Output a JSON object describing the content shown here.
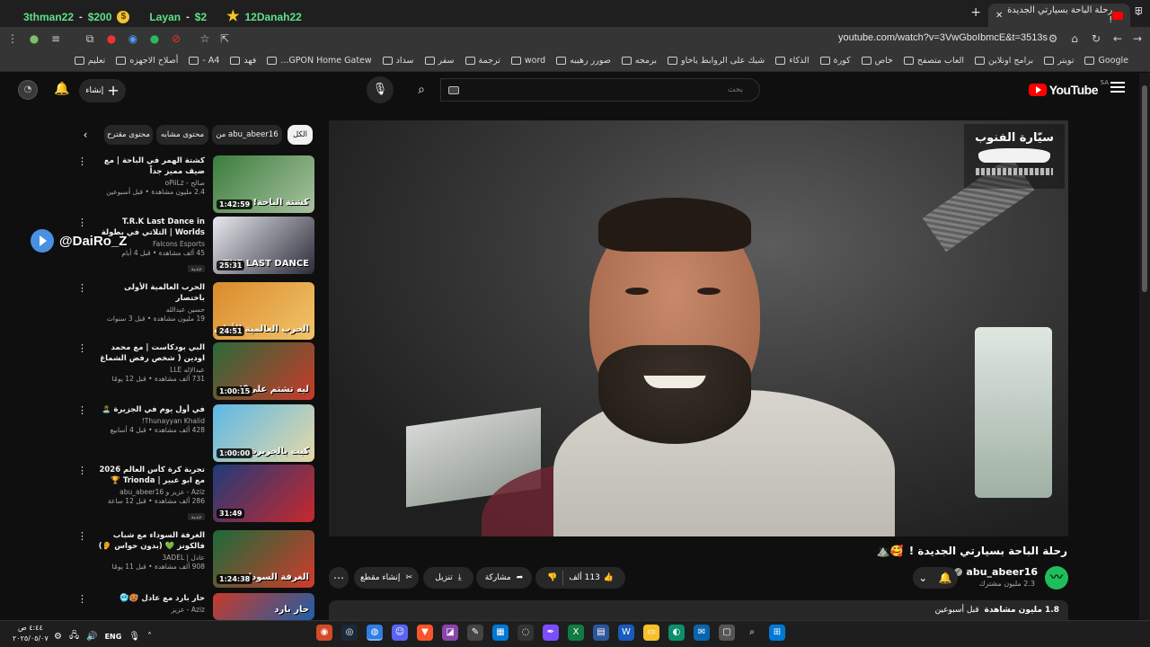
{
  "overlay": {
    "donations": [
      {
        "name": "3thman22",
        "amount": "$200"
      },
      {
        "name": "Layan",
        "amount": "$2"
      },
      {
        "name": "12Danah22",
        "amount": ""
      }
    ]
  },
  "browser": {
    "tab_title": "رحلة الباحة بسيارتي الجديدة !",
    "url": "youtube.com/watch?v=3VwGboIbmcE&t=3513s",
    "bookmarks": [
      "Google",
      "تويتر",
      "برامج اونلاين",
      "العاب متصفح",
      "خاص",
      "كورة",
      "الذكاء",
      "شيك على الروابط ياخاو",
      "برمجه",
      "صورر رهيبه",
      "word",
      "ترجمة",
      "سفر",
      "سداد",
      "GPON Home Gatew...",
      "فهد",
      "A4 -",
      "أصلاح الاجهزه",
      "تعليم"
    ]
  },
  "youtube": {
    "logo": "YouTube",
    "country": "SA",
    "search_placeholder": "بحث",
    "create_label": "إنشاء"
  },
  "chips": [
    "الكل",
    "من abu_abeer16",
    "محتوى مشابه",
    "محتوى مقترح"
  ],
  "video": {
    "title": "رحلة الباحة بسيارتي الجديدة !",
    "channel": "abu_abeer16",
    "subscribers": "2.3 مليون مشترك",
    "likes": "113 ألف",
    "share": "مشاركة",
    "download": "تنزيل",
    "clip": "إنشاء مقطع",
    "views": "1.8 مليون مشاهدة",
    "age": "قبل أسبوعين",
    "overlay_logo": "سيّارة الفنوب"
  },
  "floating_tag": "@DaiRo_Z",
  "recommendations": [
    {
      "title": "كشتة الهمر في الباحة | مع ضيف مميز جداً",
      "channel": "صالح - oPiiLz",
      "meta": "2.4 مليون مشاهدة • قبل أسبوعين",
      "duration": "1:42:59",
      "thumb_text": "كشتة الباحة!",
      "new": false,
      "bg": [
        "#3b7d3c",
        "#a8c2a0"
      ]
    },
    {
      "title": "T.R.K Last Dance in Worlds | التلاتي في بطولة العالم",
      "channel": "Falcons Esports",
      "meta": "45 ألف مشاهدة • قبل 4 أيام",
      "duration": "25:31",
      "thumb_text": "THE LAST DANCE",
      "new": true,
      "bg": [
        "#e8e8ee",
        "#2c2c3a"
      ]
    },
    {
      "title": "الحرب العالمية الأولى باختصار",
      "channel": "حسين عبدالله",
      "meta": "19 مليون مشاهدة • قبل 3 سنوات",
      "duration": "24:51",
      "thumb_text": "الحرب العالمية الأولى",
      "new": false,
      "bg": [
        "#d98b2b",
        "#f2c46a"
      ]
    },
    {
      "title": "البي بودكاست | مع محمد اودين ( شخص رفض الشماغ للتريق 😂 )",
      "channel": "عبدالإله LLE",
      "meta": "731 ألف مشاهدة • قبل 12 يومًا",
      "duration": "1:00:15",
      "thumb_text": "ليه تشتم علي؟!",
      "new": false,
      "bg": [
        "#2b6a3a",
        "#c93a2a"
      ]
    },
    {
      "title": "في أول يوم في الجزيرة 🏝️",
      "channel": "Thunayyan Khalid!",
      "meta": "428 ألف مشاهدة • قبل 4 أسابيع",
      "duration": "1:00:00",
      "thumb_text": "كبت بالجزيرة",
      "new": false,
      "bg": [
        "#5bb7e6",
        "#e7d9a6"
      ]
    },
    {
      "title": "تجربة كرة كأس العالم 2026 مع ابو عبير | Trionda 🏆",
      "channel": "Aziz - عزيز و abu_abeer16",
      "meta": "286 ألف مشاهدة • قبل 12 ساعة",
      "duration": "31:49",
      "thumb_text": "",
      "new": true,
      "bg": [
        "#1e3b7a",
        "#c9282d"
      ]
    },
    {
      "title": "الغرفة السوداء مع شباب فالكونز 💚 (بدون حواس 👂)",
      "channel": "عادل | 3ADEL",
      "meta": "908 ألف مشاهدة • قبل 11 يومًا",
      "duration": "1:24:38",
      "thumb_text": "الغرفة السوداء",
      "new": false,
      "bg": [
        "#1a6b3a",
        "#d23b2b"
      ]
    },
    {
      "title": "حار بارد مع عادل 🥵🥶",
      "channel": "Aziz - عزيز",
      "meta": "",
      "duration": "",
      "thumb_text": "حار بارد",
      "new": false,
      "bg": [
        "#c93a2a",
        "#1e5fa8"
      ]
    }
  ],
  "taskbar": {
    "time": "٤:٤٤ ص",
    "date": "٢٠٢٥/٠٥/٠٧",
    "language": "ENG"
  }
}
